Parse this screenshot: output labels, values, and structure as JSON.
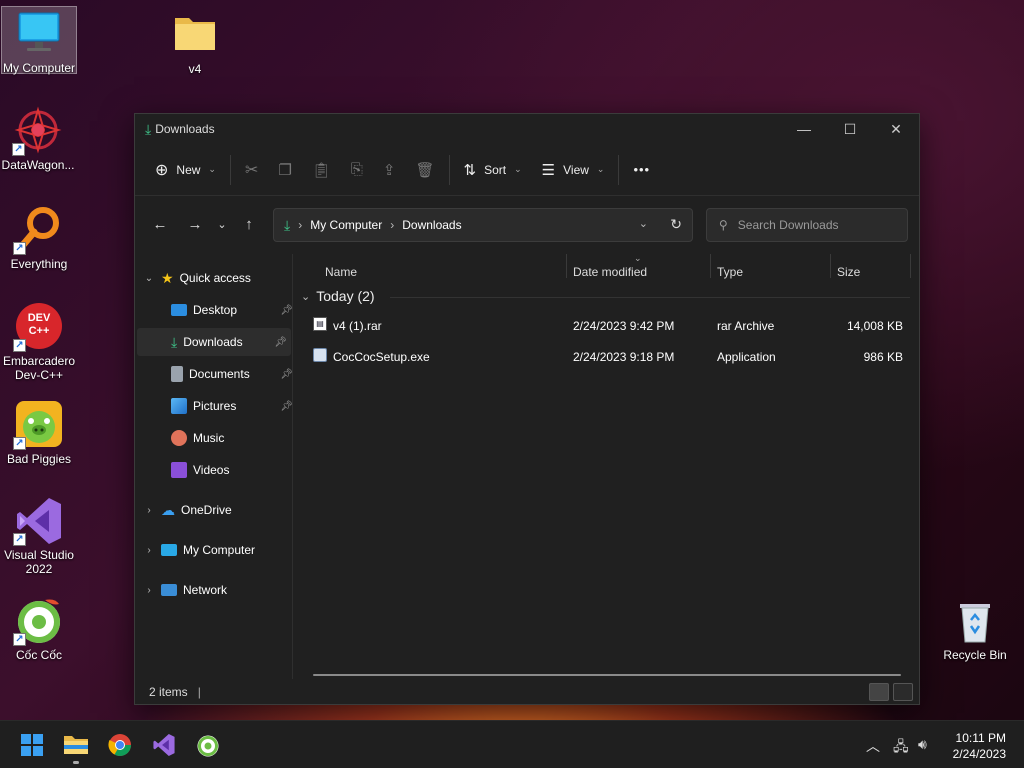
{
  "desktop": {
    "icons": [
      {
        "label": "My Computer"
      },
      {
        "label": "v4"
      },
      {
        "label": "DataWagon..."
      },
      {
        "label": "Everything"
      },
      {
        "label": "Embarcadero Dev-C++"
      },
      {
        "label": "Bad Piggies"
      },
      {
        "label": "Visual Studio 2022"
      },
      {
        "label": "Cốc Cốc"
      },
      {
        "label": "Recycle Bin"
      }
    ],
    "devcpp_text": "DEV C++"
  },
  "window": {
    "title": "Downloads",
    "toolbar": {
      "new": "New",
      "sort": "Sort",
      "view": "View",
      "more": "•••"
    },
    "breadcrumb": [
      "My Computer",
      "Downloads"
    ],
    "search_placeholder": "Search Downloads",
    "nav": {
      "quick_access": "Quick access",
      "items": [
        "Desktop",
        "Downloads",
        "Documents",
        "Pictures",
        "Music",
        "Videos"
      ],
      "onedrive": "OneDrive",
      "my_computer": "My Computer",
      "network": "Network"
    },
    "columns": {
      "name": "Name",
      "date": "Date modified",
      "type": "Type",
      "size": "Size"
    },
    "group": "Today (2)",
    "files": [
      {
        "name": "v4 (1).rar",
        "date": "2/24/2023 9:42 PM",
        "type": "rar Archive",
        "size": "14,008 KB"
      },
      {
        "name": "CocCocSetup.exe",
        "date": "2/24/2023 9:18 PM",
        "type": "Application",
        "size": "986 KB"
      }
    ],
    "status": "2 items"
  },
  "taskbar": {
    "time": "10:11 PM",
    "date": "2/24/2023"
  }
}
